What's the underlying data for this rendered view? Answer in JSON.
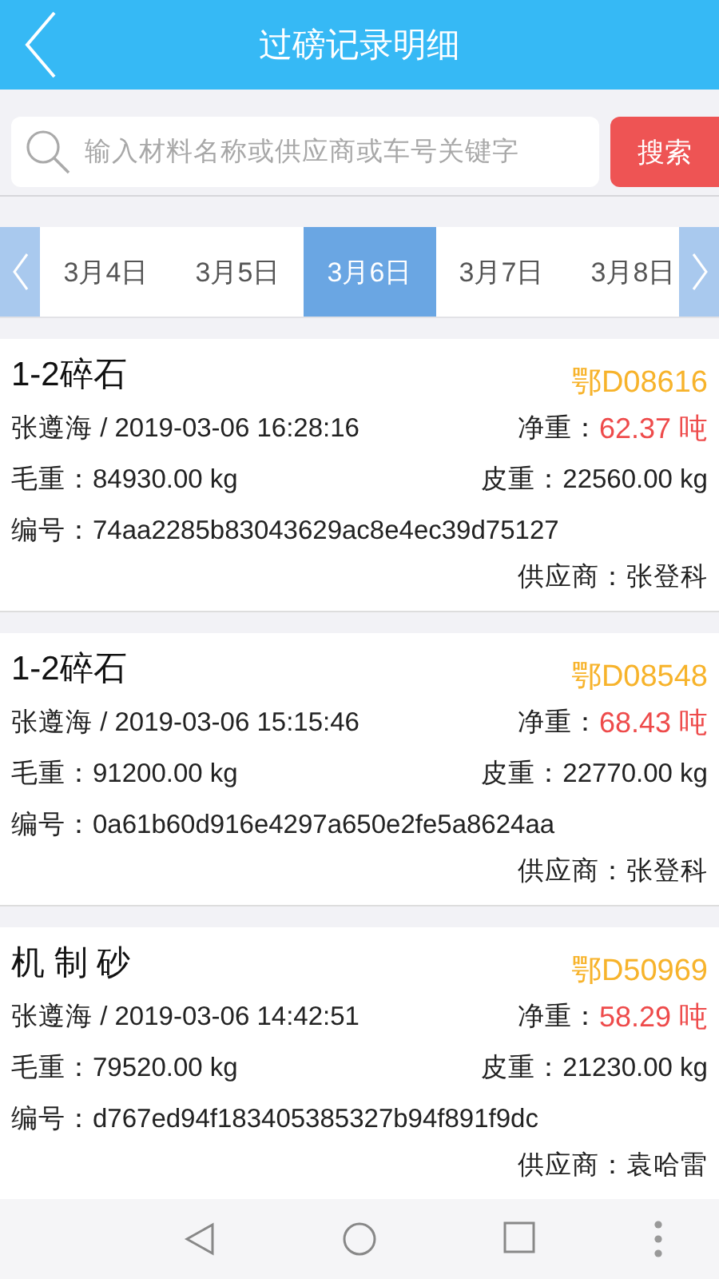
{
  "header": {
    "title": "过磅记录明细"
  },
  "search": {
    "placeholder": "输入材料名称或供应商或车号关键字",
    "button": "搜索"
  },
  "dates": [
    {
      "label": "3月4日",
      "selected": false
    },
    {
      "label": "3月5日",
      "selected": false
    },
    {
      "label": "3月6日",
      "selected": true
    },
    {
      "label": "3月7日",
      "selected": false
    },
    {
      "label": "3月8日",
      "selected": false
    }
  ],
  "records": [
    {
      "material": "1-2碎石",
      "plate": "鄂D08616",
      "operator_time": "张遵海 / 2019-03-06 16:28:16",
      "net_label": "净重：",
      "net_weight": "62.37 吨",
      "gross": "毛重：84930.00 kg",
      "tare": "皮重：22560.00 kg",
      "number": "编号：74aa2285b83043629ac8e4ec39d75127",
      "supplier": "供应商：张登科"
    },
    {
      "material": "1-2碎石",
      "plate": "鄂D08548",
      "operator_time": "张遵海 / 2019-03-06 15:15:46",
      "net_label": "净重：",
      "net_weight": "68.43 吨",
      "gross": "毛重：91200.00 kg",
      "tare": "皮重：22770.00 kg",
      "number": "编号：0a61b60d916e4297a650e2fe5a8624aa",
      "supplier": "供应商：张登科"
    },
    {
      "material": "机 制 砂",
      "plate": "鄂D50969",
      "operator_time": "张遵海 / 2019-03-06 14:42:51",
      "net_label": "净重：",
      "net_weight": "58.29 吨",
      "gross": "毛重：79520.00 kg",
      "tare": "皮重：21230.00 kg",
      "number": "编号：d767ed94f183405385327b94f891f9dc",
      "supplier": "供应商：袁哈雷"
    }
  ]
}
